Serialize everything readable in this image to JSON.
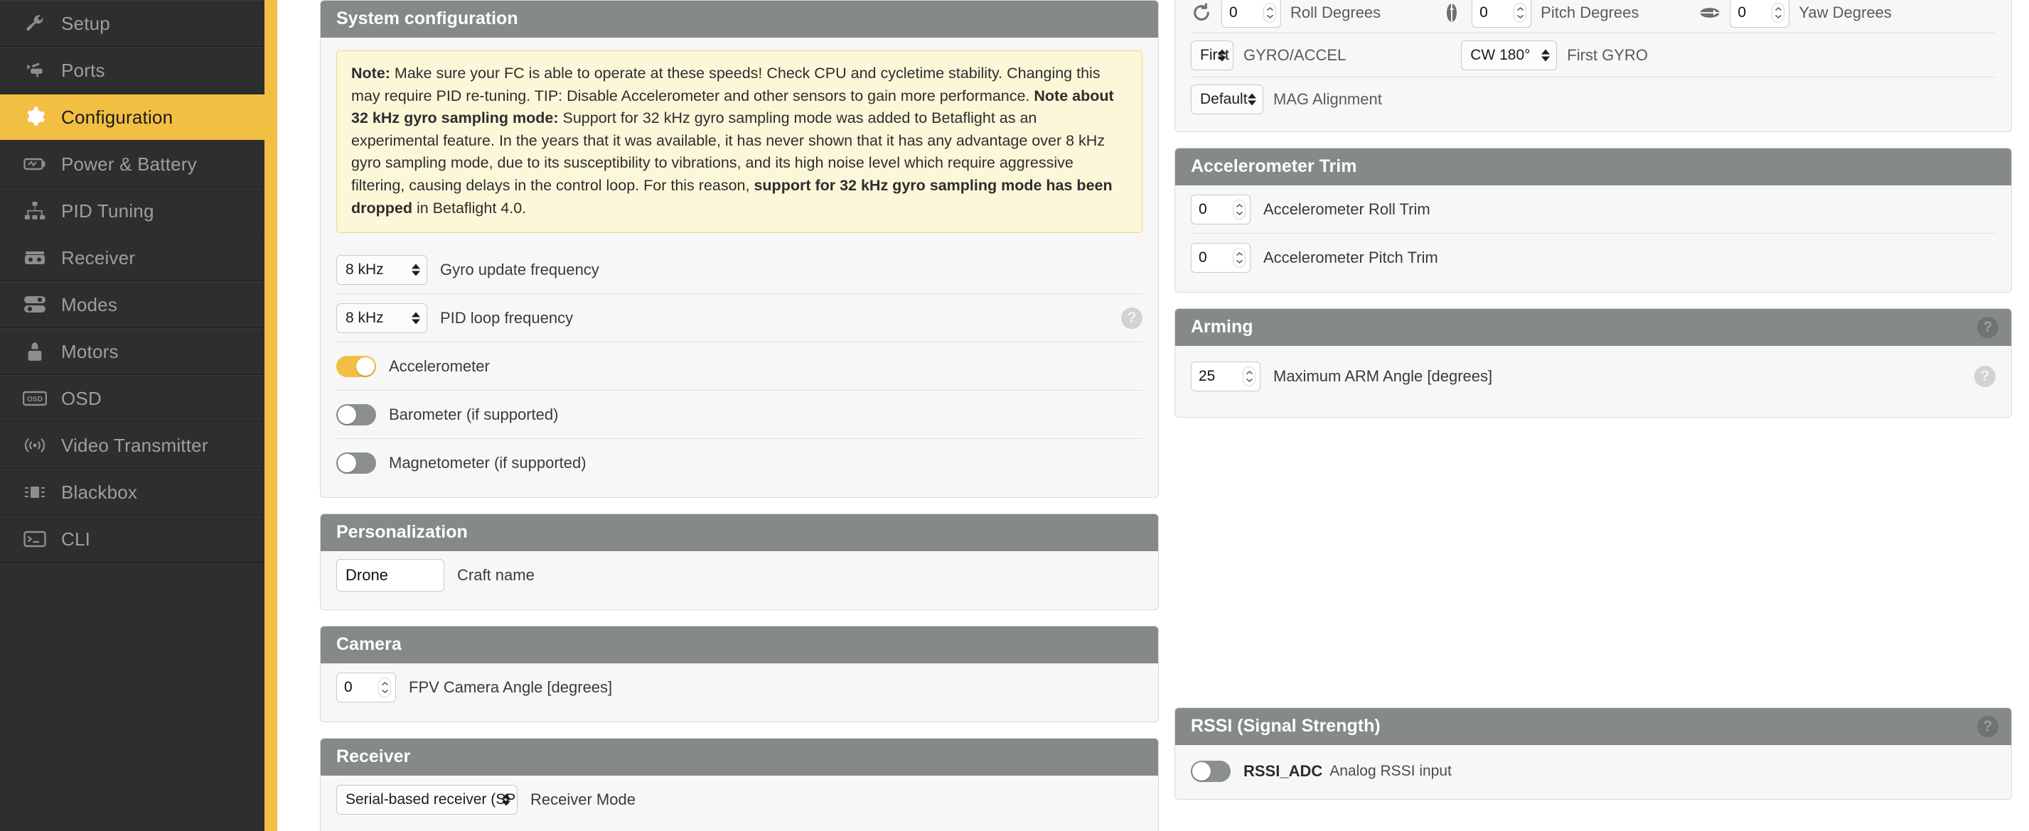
{
  "sidebar": {
    "items": [
      {
        "label": "Setup",
        "icon": "wrench-icon",
        "active": false
      },
      {
        "label": "Ports",
        "icon": "plug-icon",
        "active": false
      },
      {
        "label": "Configuration",
        "icon": "gear-icon",
        "active": true
      },
      {
        "label": "Power & Battery",
        "icon": "battery-icon",
        "active": false
      },
      {
        "label": "PID Tuning",
        "icon": "sitemap-icon",
        "active": false
      },
      {
        "label": "Receiver",
        "icon": "transmitter-icon",
        "active": false
      },
      {
        "label": "Modes",
        "icon": "sliders-icon",
        "active": false
      },
      {
        "label": "Motors",
        "icon": "motor-icon",
        "active": false
      },
      {
        "label": "OSD",
        "icon": "osd-icon",
        "active": false
      },
      {
        "label": "Video Transmitter",
        "icon": "broadcast-icon",
        "active": false
      },
      {
        "label": "Blackbox",
        "icon": "chip-icon",
        "active": false
      },
      {
        "label": "CLI",
        "icon": "terminal-icon",
        "active": false
      }
    ]
  },
  "colors": {
    "accent": "#f3bf43",
    "sidebar_bg": "#2e2e2e",
    "panel_header": "#85898a",
    "note_bg": "#fcf7d9",
    "note_border": "#e8d98a"
  },
  "system_configuration": {
    "title": "System configuration",
    "note": {
      "lead_label": "Note:",
      "lead_text": " Make sure your FC is able to operate at these speeds! Check CPU and cycletime stability. Changing this may require PID re-tuning. TIP: Disable Accelerometer and other sensors to gain more performance. ",
      "second_label": "Note about 32 kHz gyro sampling mode:",
      "second_text": " Support for 32 kHz gyro sampling mode was added to Betaflight as an experimental feature. In the years that it was available, it has never shown that it has any advantage over 8 kHz gyro sampling mode, due to its susceptibility to vibrations, and its high noise level which require aggressive filtering, causing delays in the control loop. For this reason, ",
      "bold_tail": "support for 32 kHz gyro sampling mode has been dropped",
      "tail_text": " in Betaflight 4.0."
    },
    "gyro_update": {
      "value": "8 kHz",
      "label": "Gyro update frequency"
    },
    "pid_loop": {
      "value": "8 kHz",
      "label": "PID loop frequency",
      "help": "?"
    },
    "accelerometer": {
      "label": "Accelerometer",
      "on": true
    },
    "barometer": {
      "label": "Barometer (if supported)",
      "on": false
    },
    "magnetometer": {
      "label": "Magnetometer (if supported)",
      "on": false
    }
  },
  "personalization": {
    "title": "Personalization",
    "craft_name": {
      "value": "Drone",
      "label": "Craft name",
      "placeholder": "Craft name"
    }
  },
  "camera": {
    "title": "Camera",
    "fpv_angle": {
      "value": "0",
      "label": "FPV Camera Angle [degrees]"
    }
  },
  "receiver": {
    "title": "Receiver",
    "mode": {
      "value": "Serial-based receiver (SPEKSAT, SBUS, SUMD)",
      "label": "Receiver Mode"
    }
  },
  "board_alignment": {
    "roll": {
      "value": "0",
      "label": "Roll Degrees",
      "icon": "roll-rotation-icon"
    },
    "pitch": {
      "value": "0",
      "label": "Pitch Degrees",
      "icon": "pitch-rotation-icon"
    },
    "yaw": {
      "value": "0",
      "label": "Yaw Degrees",
      "icon": "yaw-rotation-icon"
    },
    "gyro_accel_select": {
      "value": "First",
      "label": "GYRO/ACCEL"
    },
    "first_gyro_select": {
      "value": "CW 180°",
      "label": "First GYRO"
    },
    "mag_alignment": {
      "value": "Default",
      "label": "MAG Alignment"
    }
  },
  "accelerometer_trim": {
    "title": "Accelerometer Trim",
    "roll_trim": {
      "value": "0",
      "label": "Accelerometer Roll Trim"
    },
    "pitch_trim": {
      "value": "0",
      "label": "Accelerometer Pitch Trim"
    }
  },
  "arming": {
    "title": "Arming",
    "help": "?",
    "max_arm_angle": {
      "value": "25",
      "label": "Maximum ARM Angle [degrees]",
      "help": "?"
    }
  },
  "rssi": {
    "title": "RSSI (Signal Strength)",
    "help": "?",
    "adc": {
      "name": "RSSI_ADC",
      "desc": "Analog RSSI input",
      "on": false
    }
  }
}
